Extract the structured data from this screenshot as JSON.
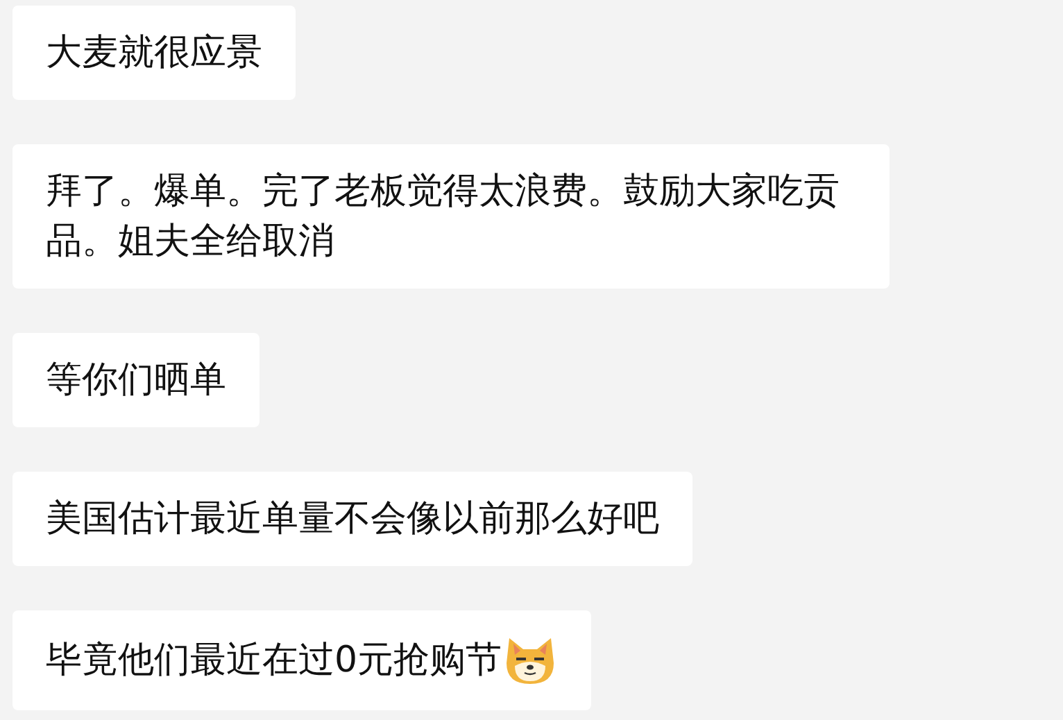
{
  "messages": [
    {
      "text": "大麦就很应景",
      "emoji": false
    },
    {
      "text": "拜了。爆单。完了老板觉得太浪费。鼓励大家吃贡品。姐夫全给取消",
      "emoji": false
    },
    {
      "text": "等你们晒单",
      "emoji": false
    },
    {
      "text": "美国估计最近单量不会像以前那么好吧",
      "emoji": false
    },
    {
      "text": "毕竟他们最近在过0元抢购节",
      "emoji": true
    }
  ]
}
